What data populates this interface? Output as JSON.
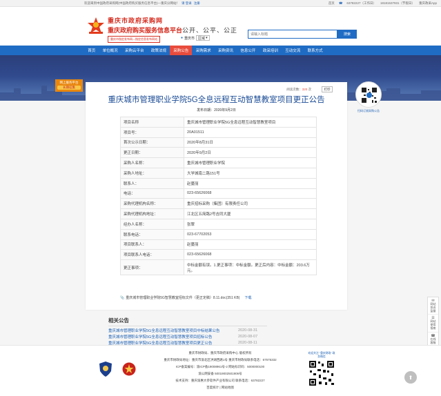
{
  "topbar": {
    "welcome": "欢迎来到中国政府采购网(中国政府购买服务信息平台)—重庆分网站！",
    "login": "请 登录",
    "register": "注册",
    "home": "首页",
    "phone1": "63782227（工作日）",
    "phone2": "18181537931（节假日）",
    "app": "重庆政采App"
  },
  "header": {
    "logo_line1": "重庆市政府采购网",
    "logo_line2": "重庆政府购买服务信息平台",
    "logo_line3": "重庆市指定发布网—指定信息发布网站",
    "slogan": "公开、公平、公正",
    "region_label": "重庆市",
    "region_select": "区域",
    "search_placeholder": "请输入标题",
    "search_button": "搜索"
  },
  "nav": {
    "items": [
      "首页",
      "单位概况",
      "采购云平台",
      "政策法规",
      "采购公告",
      "采购需求",
      "采购资讯",
      "信息公开",
      "政采培训",
      "互动交流",
      "联系方式"
    ],
    "active_index": 4
  },
  "banner": {
    "badge_line1": "网上服务平台",
    "badge_line2": "长期征集"
  },
  "article": {
    "read_label": "阅读次数",
    "read_count": "320",
    "read_unit": "次",
    "print": "打印",
    "title": "重庆城市管理职业学院5G全息远程互动智慧教室项目更正公告",
    "pub_label": "发布日期：",
    "pub_date": "2020年9月2日",
    "rows": [
      {
        "k": "项目名称",
        "v": "重庆城市管理职业学院5G全息远程互动智慧教室项目"
      },
      {
        "k": "项目号：",
        "v": "20A01511"
      },
      {
        "k": "首次公示日期：",
        "v": "2020年8月31日"
      },
      {
        "k": "更正日期：",
        "v": "2020年9月2日"
      },
      {
        "k": "采购人名称：",
        "v": "重庆城市管理职业学院"
      },
      {
        "k": "采购人地址：",
        "v": "大学城南二路151号"
      },
      {
        "k": "联系人：",
        "v": "赵蔓丽"
      },
      {
        "k": "电话：",
        "v": "023-65626068"
      },
      {
        "k": "采购代理机构名称：",
        "v": "重庆招标采购（集团）有限责任公司"
      },
      {
        "k": "采购代理机构地址：",
        "v": "江北区五简路2号吉同大厦"
      },
      {
        "k": "经办人名称：",
        "v": "张翠"
      },
      {
        "k": "联系电话：",
        "v": "023-67702053"
      },
      {
        "k": "项目联系人：",
        "v": "赵蔓丽"
      },
      {
        "k": "项目联系人电话：",
        "v": "023-65626068"
      },
      {
        "k": "更正事项：",
        "v": "中标金额有误。1.更正事项：中标金额。更正后内容：中标金额：203.6万元。"
      }
    ],
    "attachment": "重庆城市管理职业学院5G智慧教室招标文件（更正定稿）8.11.doc(351 KB)",
    "download": "下载"
  },
  "side_qr": {
    "caption": "扫码订阅采购公告"
  },
  "related": {
    "heading": "相关公告",
    "items": [
      {
        "title": "重庆城市管理职业学院5G全息远程互动智慧教室项目中标结果公告",
        "date": "2020-08-31"
      },
      {
        "title": "重庆城市管理职业学院5G全息远程互动智慧教室项目招标公告",
        "date": "2020-08-07"
      },
      {
        "title": "重庆城市管理职业学院5G全息远程互动智慧教室项目更正公告",
        "date": "2020-08-11"
      }
    ]
  },
  "side_float": {
    "items": [
      "网站\n投诉\n监督",
      "网站\n使用\n指南",
      "在线\n客服",
      "在线\n留言"
    ]
  },
  "footer": {
    "lines": [
      "重庆市财政局、重庆市政府采购中心 版权所有",
      "重庆市财政局地址：重庆市渝北区洪湖西路1号 重庆市财政局联系电话：67575332",
      "ICP备案编号：渝ICP备19008961号-2 网站标识码：5000000100",
      "渝公网安备 50019002501906号",
      "技术支持：重庆渝惠大参软件产业有限公司 联系电话：63782227",
      "百度统计 | 网站地图"
    ],
    "qr_caption": "欢迎关注 \"重庆财政\" 政务微信"
  }
}
